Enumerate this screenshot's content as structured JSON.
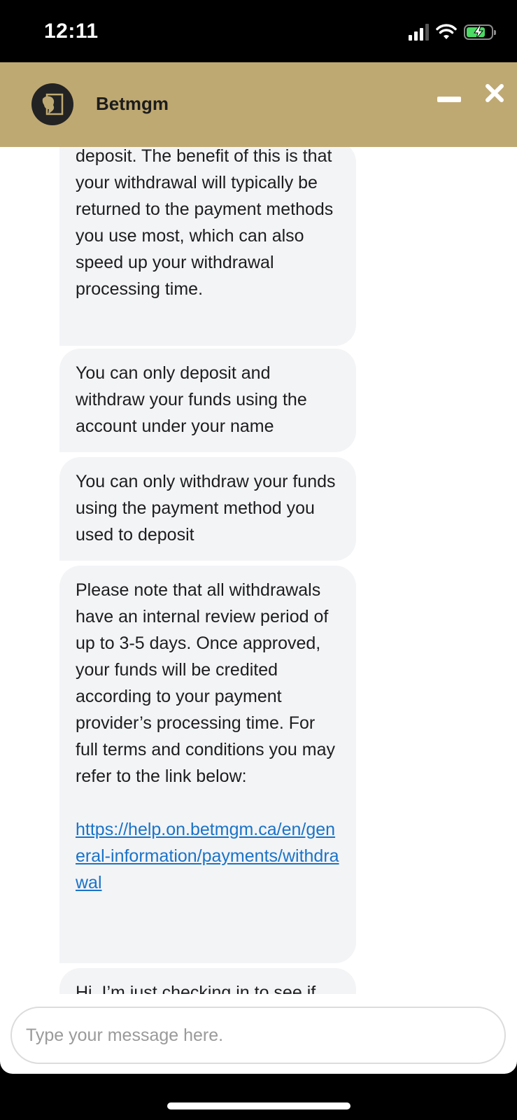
{
  "status_bar": {
    "time": "12:11"
  },
  "header": {
    "title": "Betmgm",
    "minimize_label": "Minimize",
    "close_label": "Close"
  },
  "messages": [
    {
      "text": "deposit. The benefit of this is that your withdrawal will typically be returned to the payment methods you use most, which can also speed up your withdrawal processing time."
    },
    {
      "text": "You can only deposit and withdraw your funds using the account under your name"
    },
    {
      "text": "You can only withdraw your funds using the payment method you used to deposit"
    },
    {
      "text": "Please note that all withdrawals have an internal review period of up to 3-5 days. Once approved, your funds will be credited according to your payment provider’s processing time. For full terms and conditions you may refer to the link below:",
      "link": "https://help.on.betmgm.ca/en/general-information/payments/withdrawal"
    },
    {
      "text": "Hi, I’m just checking in to see if"
    }
  ],
  "composer": {
    "placeholder": "Type your message here."
  },
  "colors": {
    "header_bg": "#bfa972",
    "bubble_bg": "#f3f4f6",
    "link": "#1a73c8"
  }
}
